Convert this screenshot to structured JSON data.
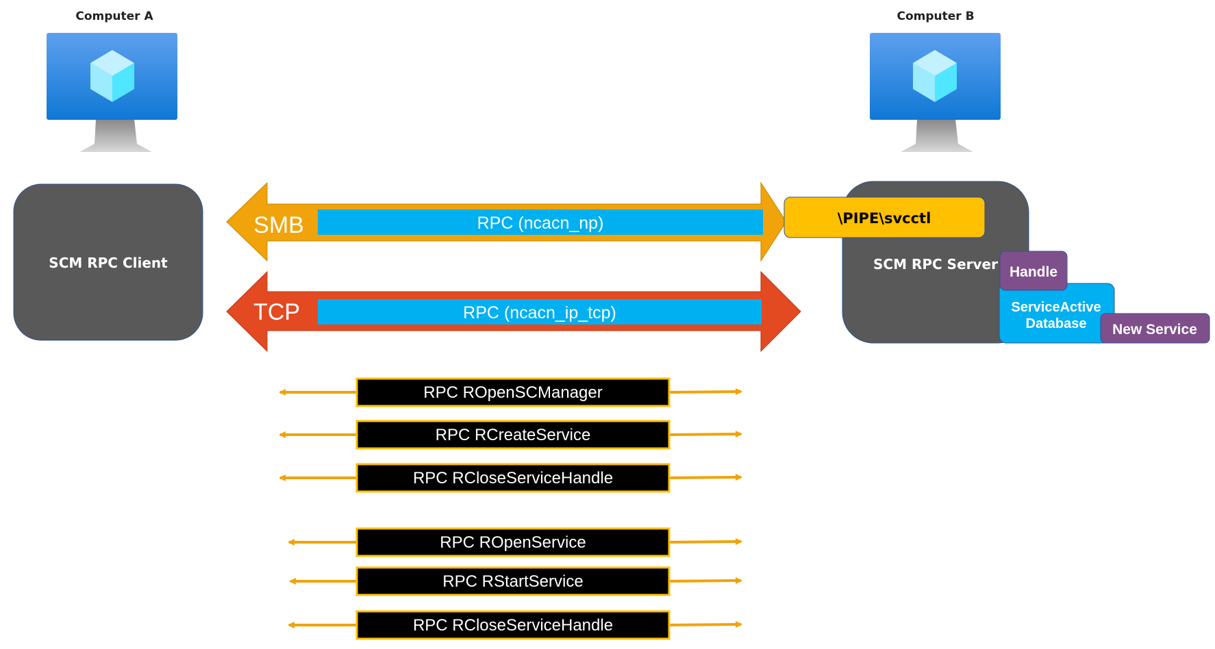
{
  "computers": {
    "a": {
      "label": "Computer A",
      "box_label": "SCM RPC Client"
    },
    "b": {
      "label": "Computer B",
      "box_label": "SCM RPC Server"
    }
  },
  "transports": {
    "smb": {
      "label": "SMB",
      "rpc": "RPC (ncacn_np)"
    },
    "tcp": {
      "label": "TCP",
      "rpc": "RPC (ncacn_ip_tcp)"
    }
  },
  "server_parts": {
    "pipe": "\\PIPE\\svcctl",
    "handle": "Handle",
    "database": [
      "ServiceActive",
      "Database"
    ],
    "new_service": "New Service"
  },
  "calls": [
    "RPC ROpenSCManager",
    "RPC RCreateService",
    "RPC RCloseServiceHandle",
    "RPC ROpenService",
    "RPC RStartService",
    "RPC RCloseServiceHandle"
  ],
  "colors": {
    "smb": "#F0A30A",
    "tcp": "#E34A22",
    "rpc_bar": "#00B0F0",
    "box": "#595959",
    "pipe": "#FFC000",
    "purple": "#7F4F8C",
    "monitor": "#1C7BDC"
  }
}
